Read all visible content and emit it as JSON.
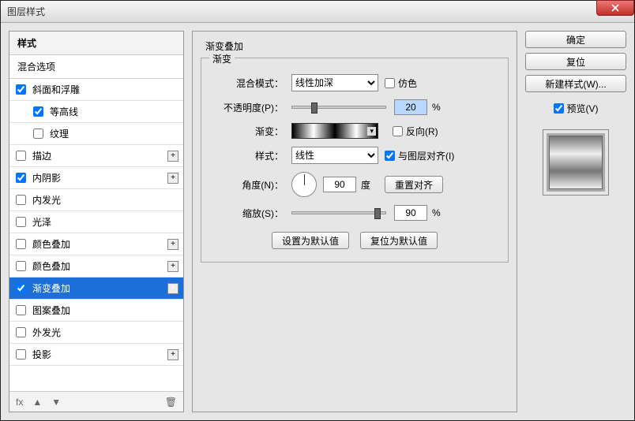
{
  "window": {
    "title": "图层样式"
  },
  "left": {
    "styles_header": "样式",
    "blend_header": "混合选项",
    "items": [
      {
        "label": "斜面和浮雕",
        "checked": true,
        "add": false,
        "sub": false
      },
      {
        "label": "等高线",
        "checked": true,
        "add": false,
        "sub": true
      },
      {
        "label": "纹理",
        "checked": false,
        "add": false,
        "sub": true
      },
      {
        "label": "描边",
        "checked": false,
        "add": true,
        "sub": false
      },
      {
        "label": "内阴影",
        "checked": true,
        "add": true,
        "sub": false
      },
      {
        "label": "内发光",
        "checked": false,
        "add": false,
        "sub": false
      },
      {
        "label": "光泽",
        "checked": false,
        "add": false,
        "sub": false
      },
      {
        "label": "颜色叠加",
        "checked": false,
        "add": true,
        "sub": false
      },
      {
        "label": "颜色叠加",
        "checked": false,
        "add": true,
        "sub": false
      },
      {
        "label": "渐变叠加",
        "checked": true,
        "add": true,
        "sub": false,
        "selected": true
      },
      {
        "label": "图案叠加",
        "checked": false,
        "add": false,
        "sub": false
      },
      {
        "label": "外发光",
        "checked": false,
        "add": false,
        "sub": false
      },
      {
        "label": "投影",
        "checked": false,
        "add": true,
        "sub": false
      }
    ],
    "footer": {
      "fx": "fx",
      "up": "▲",
      "down": "▼",
      "trash": "🗑"
    }
  },
  "center": {
    "outer_title": "渐变叠加",
    "group_title": "渐变",
    "blend_mode_label": "混合模式：",
    "blend_mode_value": "线性加深",
    "dither_label": "仿色",
    "opacity_label": "不透明度(P)：",
    "opacity_value": "20",
    "percent": "%",
    "gradient_label": "渐变：",
    "reverse_label": "反向(R)",
    "style_label": "样式：",
    "style_value": "线性",
    "align_label": "与图层对齐(I)",
    "align_checked": true,
    "angle_label": "角度(N)：",
    "angle_value": "90",
    "degree": "度",
    "reset_align": "重置对齐",
    "scale_label": "缩放(S)：",
    "scale_value": "90",
    "set_default": "设置为默认值",
    "reset_default": "复位为默认值"
  },
  "right": {
    "ok": "确定",
    "cancel": "复位",
    "new_style": "新建样式(W)...",
    "preview_label": "预览(V)",
    "preview_checked": true
  }
}
